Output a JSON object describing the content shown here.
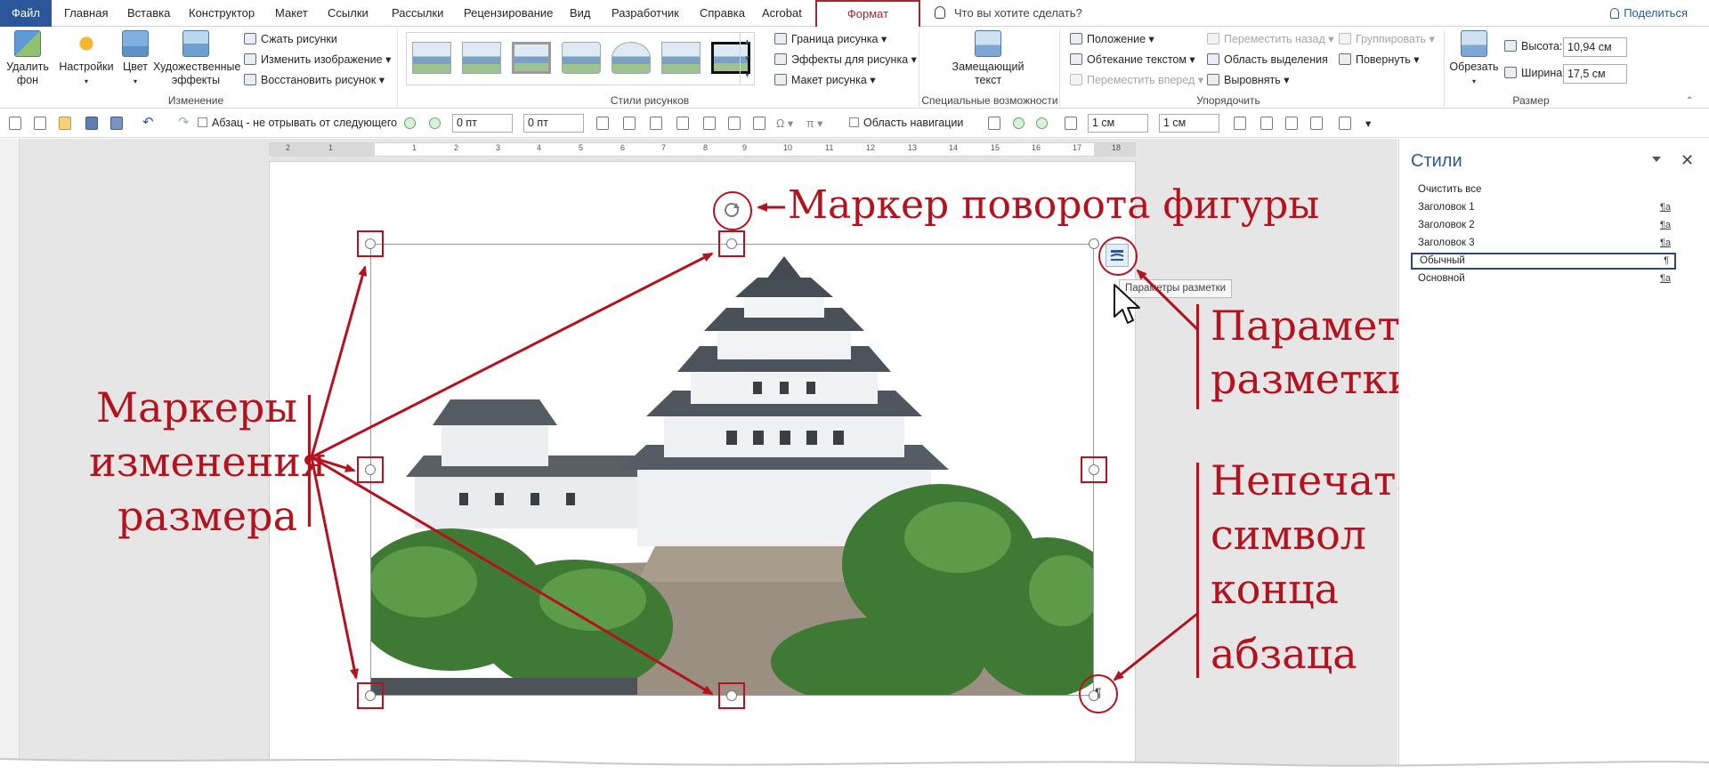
{
  "tabs": {
    "file": "Файл",
    "items": [
      "Главная",
      "Вставка",
      "Конструктор",
      "Макет",
      "Ссылки",
      "Рассылки",
      "Рецензирование",
      "Вид",
      "Разработчик",
      "Справка",
      "Acrobat"
    ],
    "active": "Формат",
    "tell_me": "Что вы хотите сделать?",
    "share": "Поделиться"
  },
  "ribbon": {
    "remove_bg": "Удалить фон",
    "corrections": "Настройки",
    "color": "Цвет",
    "artistic": "Художественные эффекты",
    "compress": "Сжать рисунки",
    "change_picture": "Изменить изображение",
    "reset_picture": "Восстановить рисунок",
    "group_adjust": "Изменение",
    "group_styles": "Стили рисунков",
    "border": "Граница рисунка",
    "effects": "Эффекты для рисунка",
    "layout": "Макет рисунка",
    "alt_text": "Замещающий текст",
    "group_access": "Специальные возможности",
    "position": "Положение",
    "wrap": "Обтекание текстом",
    "forward": "Переместить вперед",
    "backward": "Переместить назад",
    "selection_pane": "Область выделения",
    "align": "Выровнять",
    "group": "Группировать",
    "rotate": "Повернуть",
    "group_arrange": "Упорядочить",
    "crop": "Обрезать",
    "height_label": "Высота:",
    "height_value": "10,94 см",
    "width_label": "Ширина:",
    "width_value": "17,5 см",
    "group_size": "Размер"
  },
  "quickbar": {
    "keep_with_next": "Абзац - не отрывать от следующего",
    "spacing_before": "0 пт",
    "spacing_after": "0 пт",
    "nav_pane": "Область навигации",
    "indent1": "1 см",
    "indent2": "1 см"
  },
  "ruler_numbers": [
    "2",
    "1",
    "1",
    "2",
    "3",
    "4",
    "5",
    "6",
    "7",
    "8",
    "9",
    "10",
    "11",
    "12",
    "13",
    "14",
    "15",
    "16",
    "17",
    "18"
  ],
  "tooltip": "Параметры разметки",
  "annotations": {
    "rotate": "Маркер поворота фигуры",
    "resize_l1": "Маркеры",
    "resize_l2": "изменения",
    "resize_l3": "размера",
    "layout_l1": "Параметры",
    "layout_l2": "разметки",
    "para_l1": "Непечатаемый",
    "para_l2": "символ",
    "para_l3": "конца",
    "para_l4": "абзаца"
  },
  "styles_pane": {
    "title": "Стили",
    "close": "✕",
    "items": [
      {
        "name": "Очистить все",
        "mark": ""
      },
      {
        "name": "Заголовок 1",
        "mark": "¶a"
      },
      {
        "name": "Заголовок 2",
        "mark": "¶a"
      },
      {
        "name": "Заголовок 3",
        "mark": "¶a"
      },
      {
        "name": "Обычный",
        "mark": "¶"
      },
      {
        "name": "Основной",
        "mark": "¶a"
      }
    ]
  },
  "colors": {
    "accent": "#2b579a",
    "annotation": "#b3121e"
  }
}
